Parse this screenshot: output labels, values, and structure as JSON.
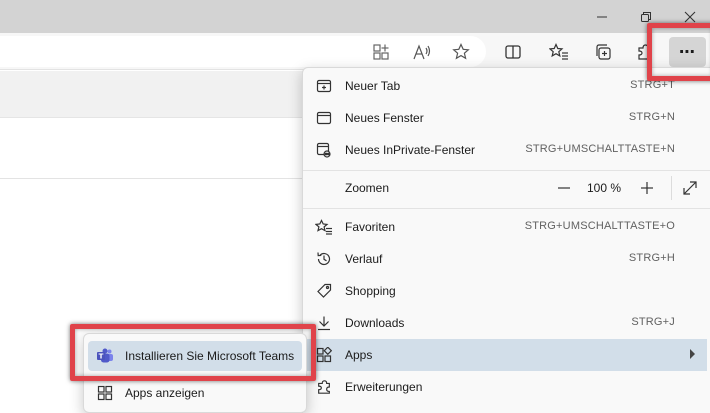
{
  "window": {
    "minimize_icon": "minimize-icon",
    "restore_icon": "restore-icon",
    "close_icon": "close-icon"
  },
  "toolbar": {
    "icons": [
      "app-available-icon",
      "read-aloud-icon",
      "favorite-star-icon",
      "split-screen-icon",
      "favorites-icon",
      "collections-icon",
      "extensions-icon"
    ],
    "more_label": "⋯"
  },
  "menu": {
    "items": [
      {
        "label": "Neuer Tab",
        "shortcut": "STRG+T",
        "icon": "new-tab-icon"
      },
      {
        "label": "Neues Fenster",
        "shortcut": "STRG+N",
        "icon": "new-window-icon"
      },
      {
        "label": "Neues InPrivate-Fenster",
        "shortcut": "STRG+UMSCHALTTASTE+N",
        "icon": "inprivate-window-icon"
      },
      {
        "label": "Zoomen",
        "shortcut": "",
        "icon": ""
      },
      {
        "label": "Favoriten",
        "shortcut": "STRG+UMSCHALTTASTE+O",
        "icon": "favorites-icon"
      },
      {
        "label": "Verlauf",
        "shortcut": "STRG+H",
        "icon": "history-icon"
      },
      {
        "label": "Shopping",
        "shortcut": "",
        "icon": "shopping-tag-icon"
      },
      {
        "label": "Downloads",
        "shortcut": "STRG+J",
        "icon": "download-icon"
      },
      {
        "label": "Apps",
        "shortcut": "",
        "icon": "apps-icon"
      },
      {
        "label": "Erweiterungen",
        "shortcut": "",
        "icon": "extensions-icon"
      }
    ],
    "zoom": {
      "minus": "—",
      "value": "100 %",
      "plus": "+"
    }
  },
  "submenu": {
    "items": [
      {
        "label": "Installieren Sie Microsoft Teams",
        "icon": "teams-icon"
      },
      {
        "label": "Apps anzeigen",
        "icon": "apps-grid-icon"
      }
    ]
  },
  "colors": {
    "callout": "#e0434a",
    "highlight": "#d2dee9",
    "menu_bg": "#f9f9f9"
  }
}
